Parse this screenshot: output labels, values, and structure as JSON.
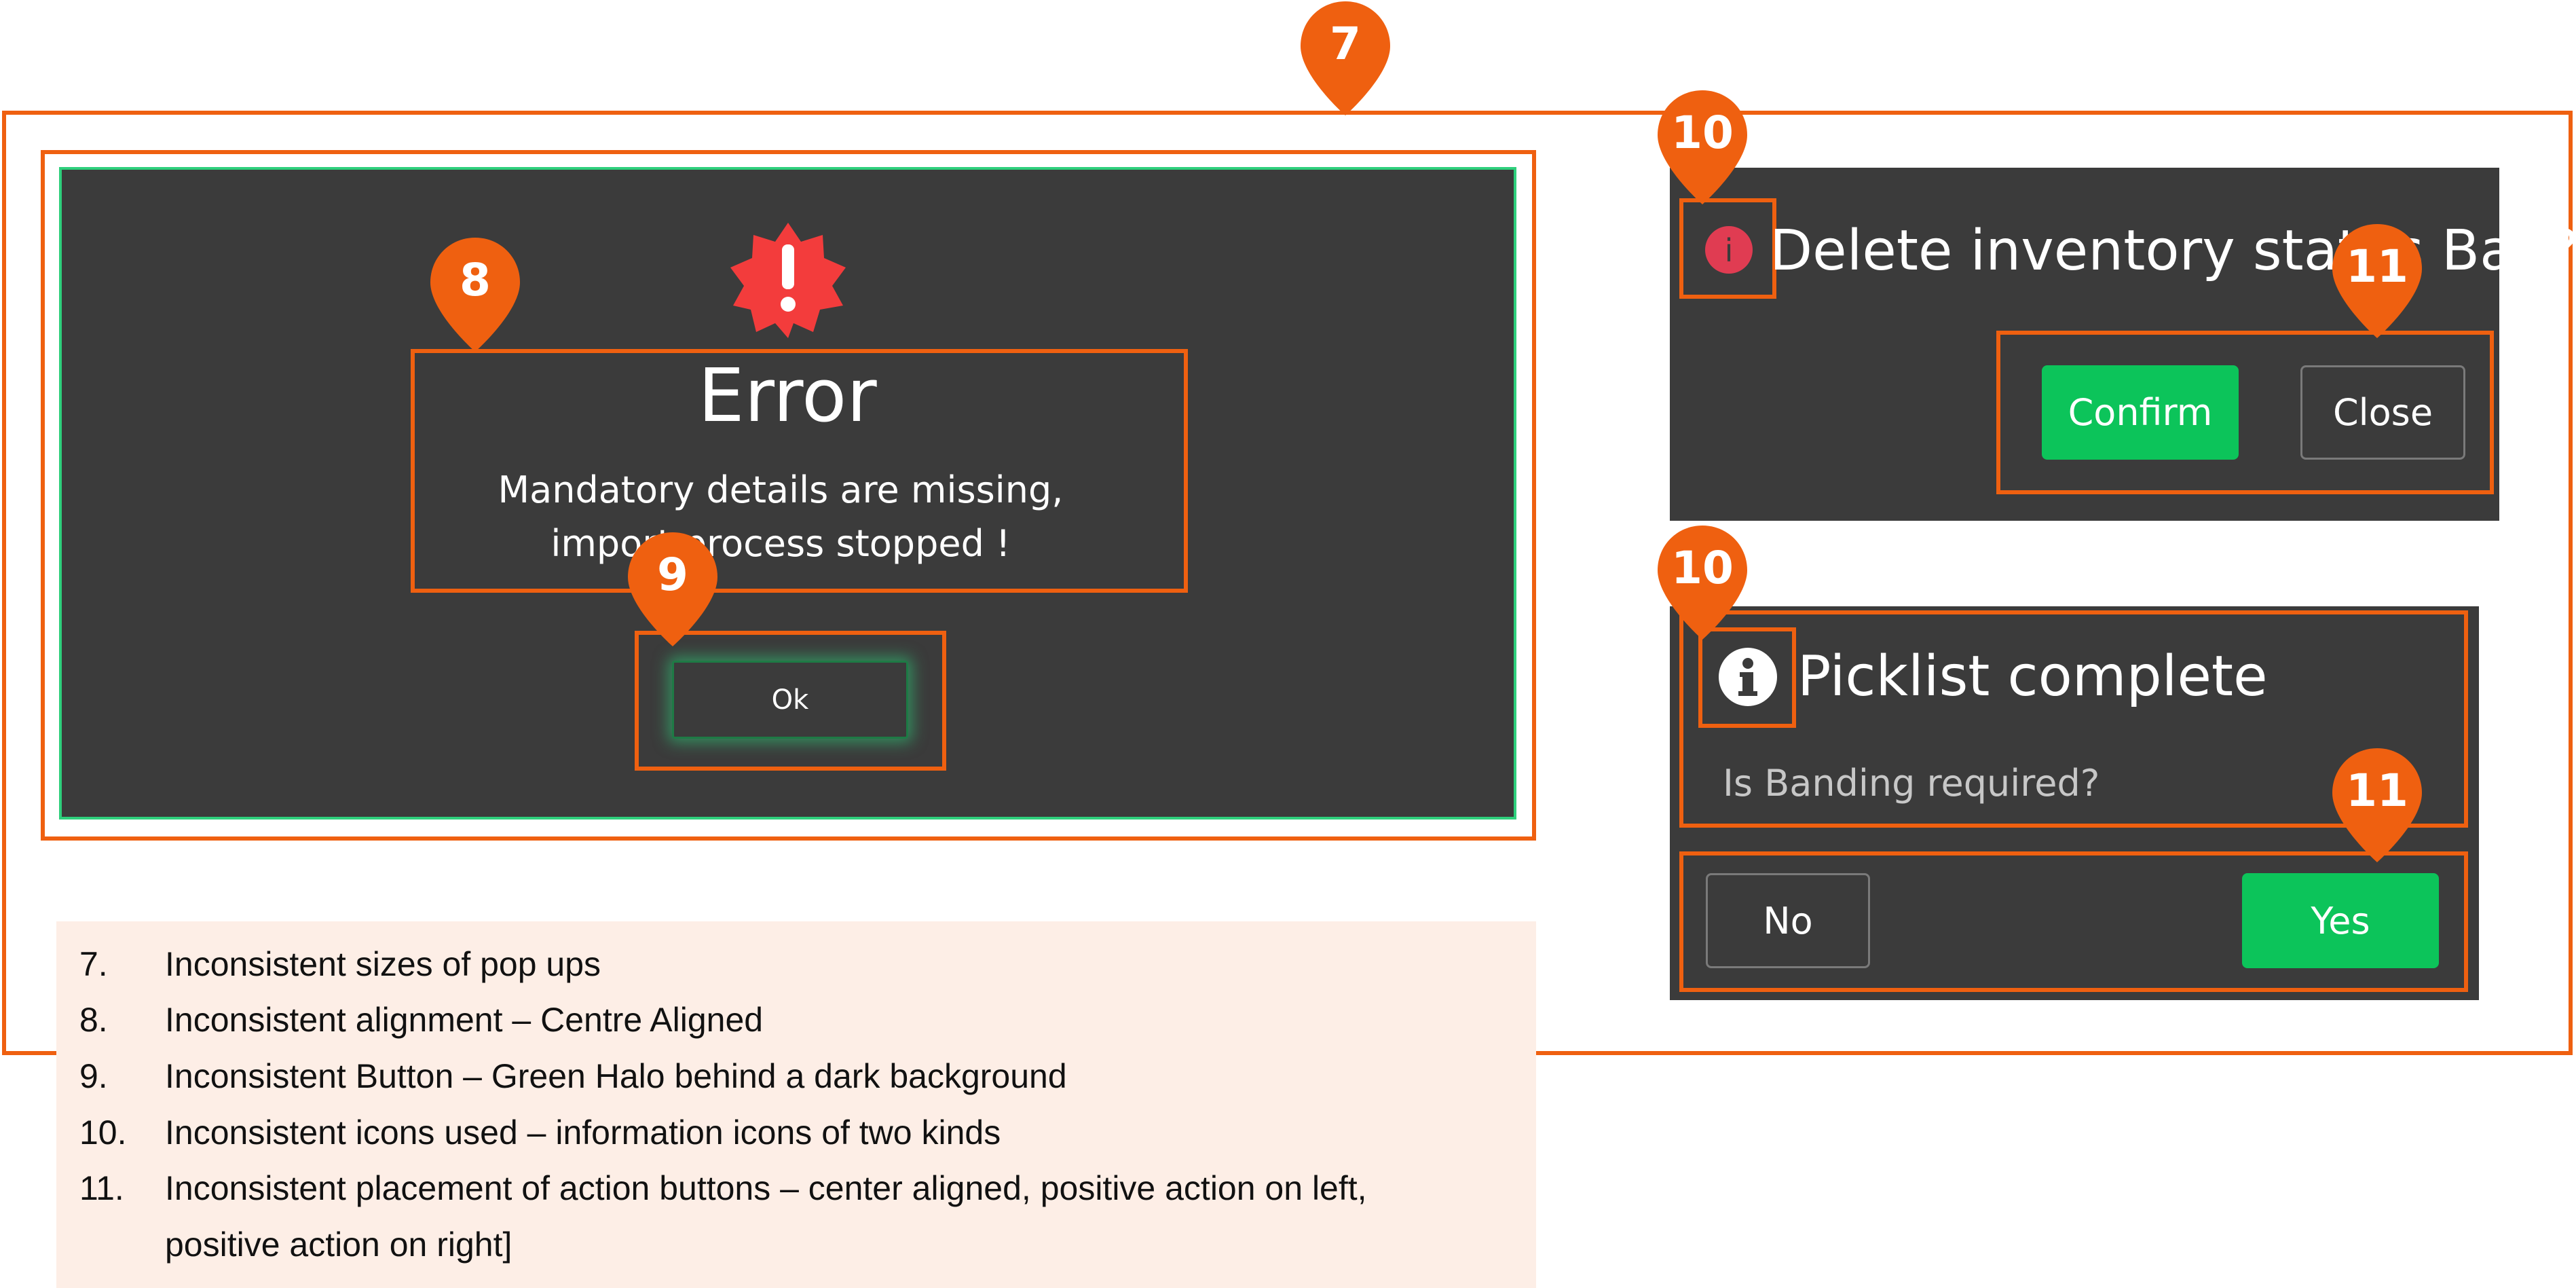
{
  "error_dialog": {
    "title": "Error",
    "message": "Mandatory details are missing, import process stopped !",
    "ok_label": "Ok",
    "icon": "error-badge-icon"
  },
  "delete_dialog": {
    "title": "Delete inventory status Bad?",
    "confirm_label": "Confirm",
    "close_label": "Close",
    "icon": "info-circle-icon"
  },
  "picklist_dialog": {
    "title": "Picklist complete",
    "question": "Is Banding required?",
    "no_label": "No",
    "yes_label": "Yes",
    "icon": "info-circle-icon"
  },
  "pins": [
    "7",
    "8",
    "9",
    "10",
    "11",
    "10",
    "11"
  ],
  "notes": [
    {
      "num": "7.",
      "text": "Inconsistent sizes of pop ups"
    },
    {
      "num": "8.",
      "text": "Inconsistent alignment – Centre Aligned"
    },
    {
      "num": "9.",
      "text": "Inconsistent Button – Green Halo behind a dark background"
    },
    {
      "num": "10.",
      "text": "Inconsistent icons used – information icons of two kinds"
    },
    {
      "num": "11.",
      "text": "Inconsistent placement of action buttons – center aligned, positive action on left,"
    },
    {
      "num": "",
      "text": "positive action on right]"
    }
  ],
  "colors": {
    "annotation_orange": "#ef6010",
    "dialog_background": "#3b3b3b",
    "positive_button": "#0cc45a",
    "error_red": "#f33c3c",
    "notes_background": "#fdeee6"
  }
}
